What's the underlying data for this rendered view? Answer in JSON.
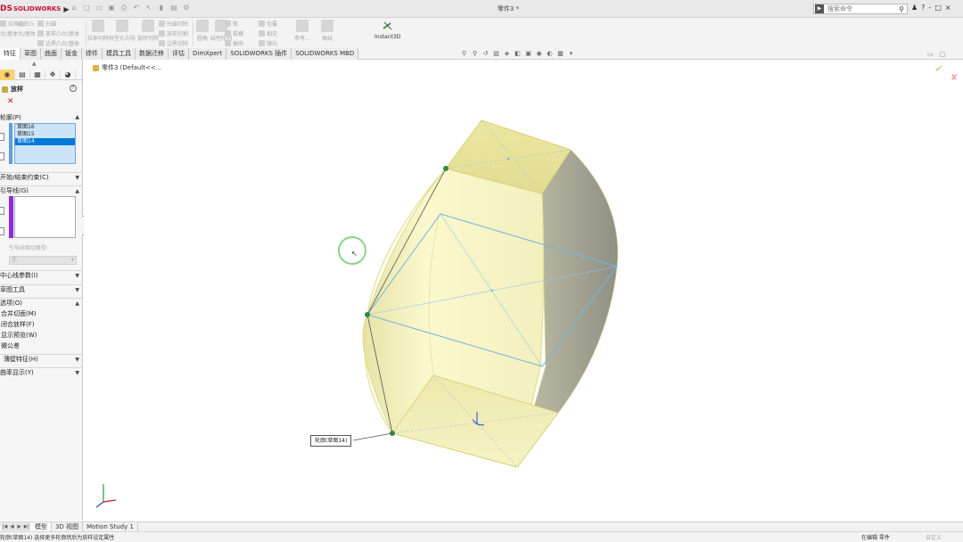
{
  "app": {
    "logo_ds": "DS",
    "logo_name": "SOLIDWORKS",
    "doc_title": "零件3 *",
    "search_placeholder": "搜索命令",
    "title_icons": [
      "?",
      "-",
      "□",
      "×"
    ]
  },
  "ribbon": {
    "group1": [
      "拉伸凸",
      "旋转凸",
      "台/基体",
      "台/基体"
    ],
    "group2": [
      "扫描",
      "放样凸台/基体",
      "边界凸台/基体"
    ],
    "group3": [
      "拉伸切除",
      "异型孔向导",
      "旋转切除"
    ],
    "group4": [
      "扫描切除",
      "放样切割",
      "边界切除"
    ],
    "group5": [
      "圆角",
      "线性阵列",
      "筋",
      "拔模",
      "抽壳",
      "包覆",
      "相交",
      "镜向"
    ],
    "group6": [
      "参考...",
      "曲线"
    ],
    "instant3d": "Instant3D"
  },
  "tabs": [
    "特征",
    "草图",
    "曲面",
    "钣金",
    "焊件",
    "模具工具",
    "数据迁移",
    "评估",
    "DimXpert",
    "SOLIDWORKS 插件",
    "SOLIDWORKS MBD"
  ],
  "active_tab": 0,
  "panel": {
    "title": "放样",
    "sections": {
      "profiles": "轮廓(P)",
      "start_end": "开始/结束约束(C)",
      "guides": "引导线(G)",
      "centerline": "中心线参数(I)",
      "sketch_tools": "草图工具",
      "options": "选项(O)",
      "thin": "薄壁特征(H)",
      "curvature": "曲率显示(Y)"
    },
    "profile_items": [
      "草图16",
      "草图15",
      "草图14"
    ],
    "selected_profile": 2,
    "tangency_label": "引导线相切类型:",
    "tangency_value": "无",
    "options": [
      "合并切面(M)",
      "闭合放样(F)",
      "显示预览(W)",
      "微公差"
    ]
  },
  "graphics": {
    "tree_item": "零件3  (Default<<...",
    "callout": "轮廓(草图14)"
  },
  "bottom_tabs": [
    "模型",
    "3D 视图",
    "Motion Study 1"
  ],
  "active_bottom_tab": 0,
  "status": {
    "left": "轮廓(草图14)    选择更多轮廓然后为放样设定属性",
    "right": "在编辑 零件",
    "extra": "自定义"
  }
}
